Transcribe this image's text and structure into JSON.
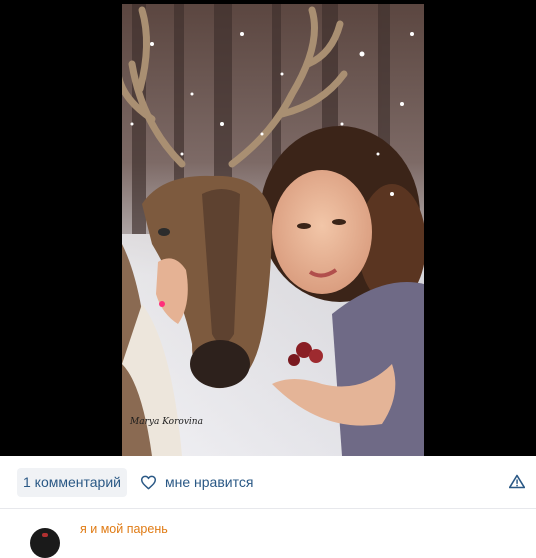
{
  "photo": {
    "watermark": "Marya Korovina"
  },
  "actions": {
    "comments_label": "1 комментарий",
    "like_label": "мне нравится",
    "like_icon": "heart-outline-icon",
    "report_icon": "warning-triangle-icon",
    "accent_color": "#2a5885"
  },
  "comment": {
    "text": "я и мой парень",
    "text_color": "#e07b14"
  }
}
